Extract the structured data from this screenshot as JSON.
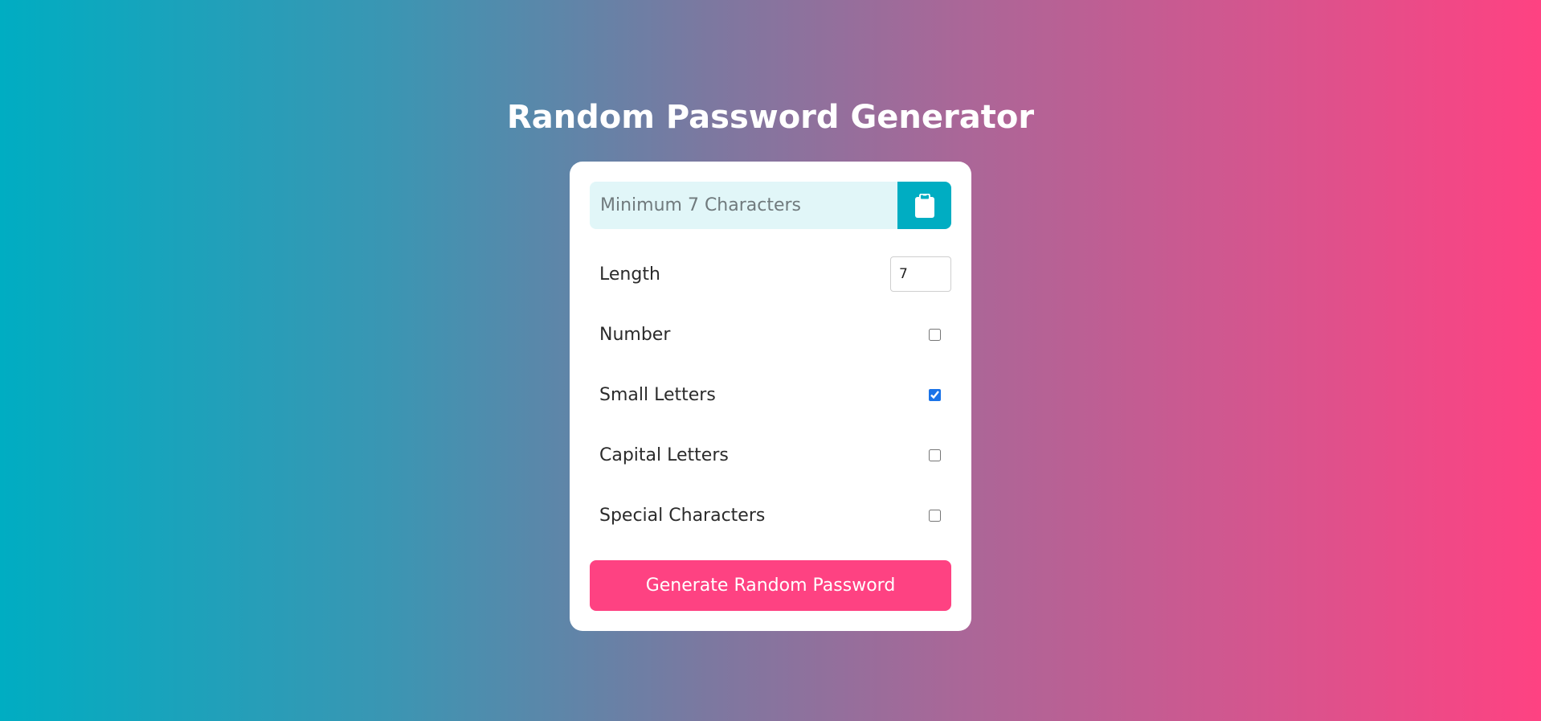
{
  "page": {
    "title": "Random Password Generator"
  },
  "password": {
    "value": "",
    "placeholder": "Minimum 7 Characters",
    "copy_icon": "clipboard-icon"
  },
  "options": {
    "length": {
      "label": "Length",
      "value": "7"
    },
    "number": {
      "label": "Number",
      "checked": false
    },
    "small_letters": {
      "label": "Small Letters",
      "checked": true
    },
    "capital_letters": {
      "label": "Capital Letters",
      "checked": false
    },
    "special_characters": {
      "label": "Special Characters",
      "checked": false
    }
  },
  "generate_button": {
    "label": "Generate Random Password"
  },
  "colors": {
    "gradient_start": "#00adc2",
    "gradient_end": "#fe4282",
    "accent_teal": "#00adc2",
    "accent_pink": "#fe4282",
    "input_bg": "#e1f6f8",
    "checkbox_blue": "#1a73e8"
  }
}
